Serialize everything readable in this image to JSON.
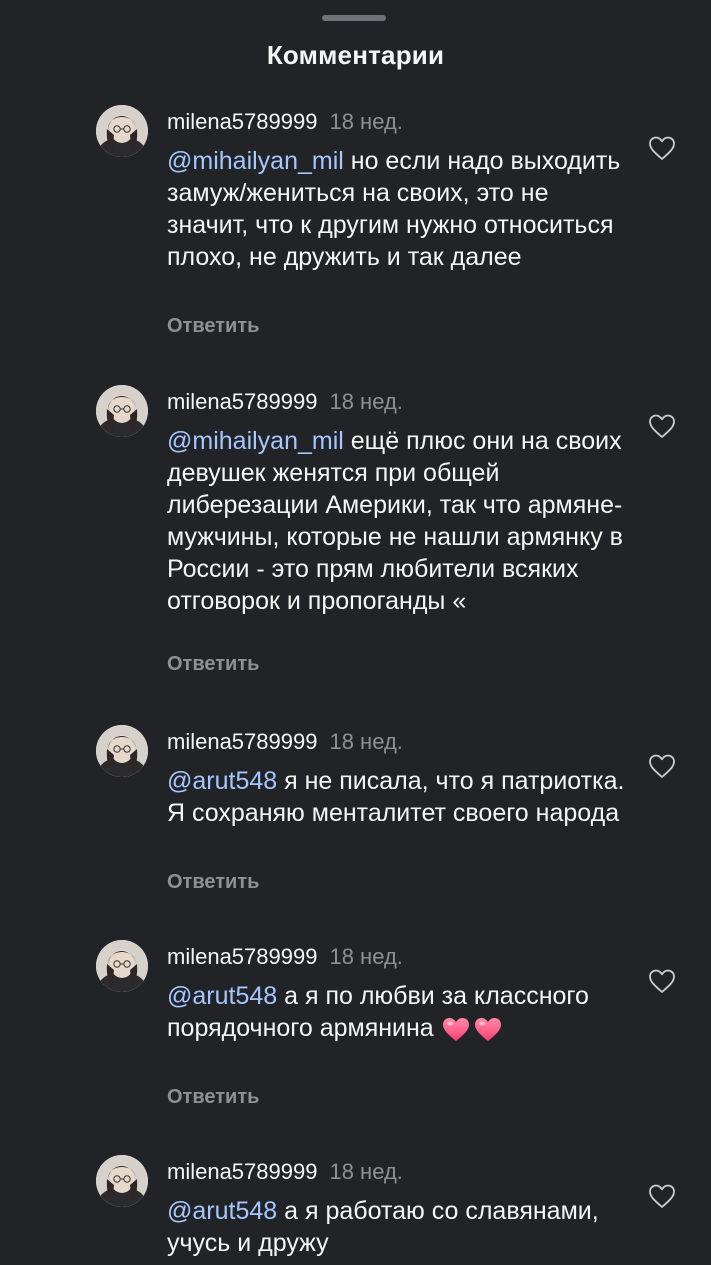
{
  "sheet": {
    "title": "Комментарии"
  },
  "comments": [
    {
      "username": "milena5789999",
      "time": "18 нед.",
      "mention": "@mihailyan_mil",
      "text": " но если надо выходить замуж/жениться на своих, это не значит, что к другим нужно относиться плохо, не дружить и так далее",
      "reply_label": "Ответить",
      "avatar": "avatar-icon",
      "like": "heart-outline-icon"
    },
    {
      "username": "milena5789999",
      "time": "18 нед.",
      "mention": "@mihailyan_mil",
      "text": " ещё плюс они на своих девушек женятся при общей либерезации Америки, так что армяне-мужчины, которые не нашли армянку в России - это прям любители всяких отговорок и пропоганды «",
      "reply_label": "Ответить",
      "avatar": "avatar-icon",
      "like": "heart-outline-icon"
    },
    {
      "username": "milena5789999",
      "time": "18 нед.",
      "mention": "@arut548",
      "text": " я не писала, что я патриотка. Я сохраняю менталитет своего народа",
      "reply_label": "Ответить",
      "avatar": "avatar-icon",
      "like": "heart-outline-icon"
    },
    {
      "username": "milena5789999",
      "time": "18 нед.",
      "mention": "@arut548",
      "text": " а я по любви за классного порядочного армянина",
      "emoji": [
        "pink-heart-icon",
        "pink-heart-icon"
      ],
      "reply_label": "Ответить",
      "avatar": "avatar-icon",
      "like": "heart-outline-icon"
    },
    {
      "username": "milena5789999",
      "time": "18 нед.",
      "mention": "@arut548",
      "text": " а я работаю со славянами, учусь и дружу",
      "avatar": "avatar-icon",
      "like": "heart-outline-icon"
    }
  ],
  "colors": {
    "background": "#212326",
    "text": "#f5f5f5",
    "muted": "#8d9095",
    "mention": "#a5c7ff",
    "heart": "#ff4f7a"
  }
}
